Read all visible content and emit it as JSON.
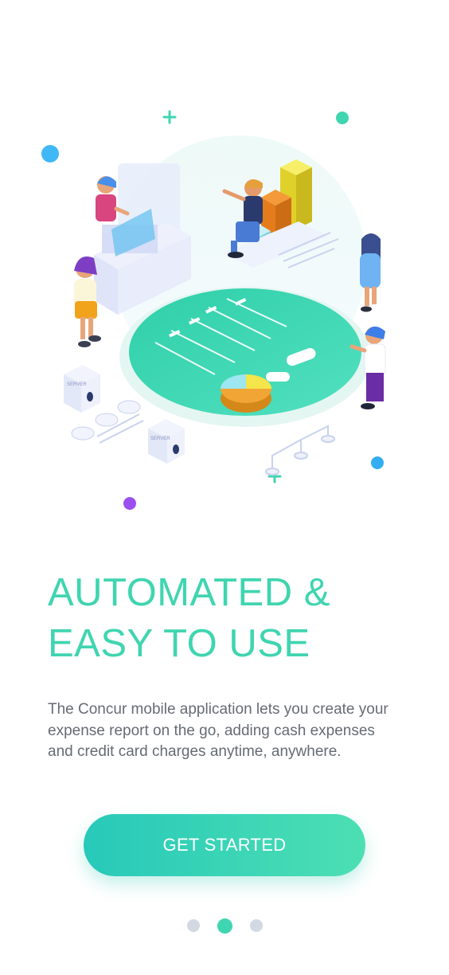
{
  "onboarding": {
    "headline_line1": "AUTOMATED &",
    "headline_line2": "EASY TO USE",
    "description": "The Concur mobile application lets you create your expense report on the go, adding cash expenses and credit card charges anytime, anywhere.",
    "cta_label": "GET STARTED"
  },
  "illustration": {
    "server_label": "SERVER",
    "icons": [
      "plus-sparkle-icon",
      "cloud-icon",
      "gear-icon",
      "bar-chart-icon",
      "pie-chart-icon",
      "person-icon"
    ]
  },
  "pager": {
    "page_count": 3,
    "active_index": 1
  },
  "colors": {
    "accent": "#3fd5b0",
    "button_gradient_start": "#27c9b9",
    "button_gradient_end": "#4ddfb3",
    "dot_inactive": "#d3d9e3",
    "body_text": "#666b73",
    "background": "#ffffff"
  }
}
